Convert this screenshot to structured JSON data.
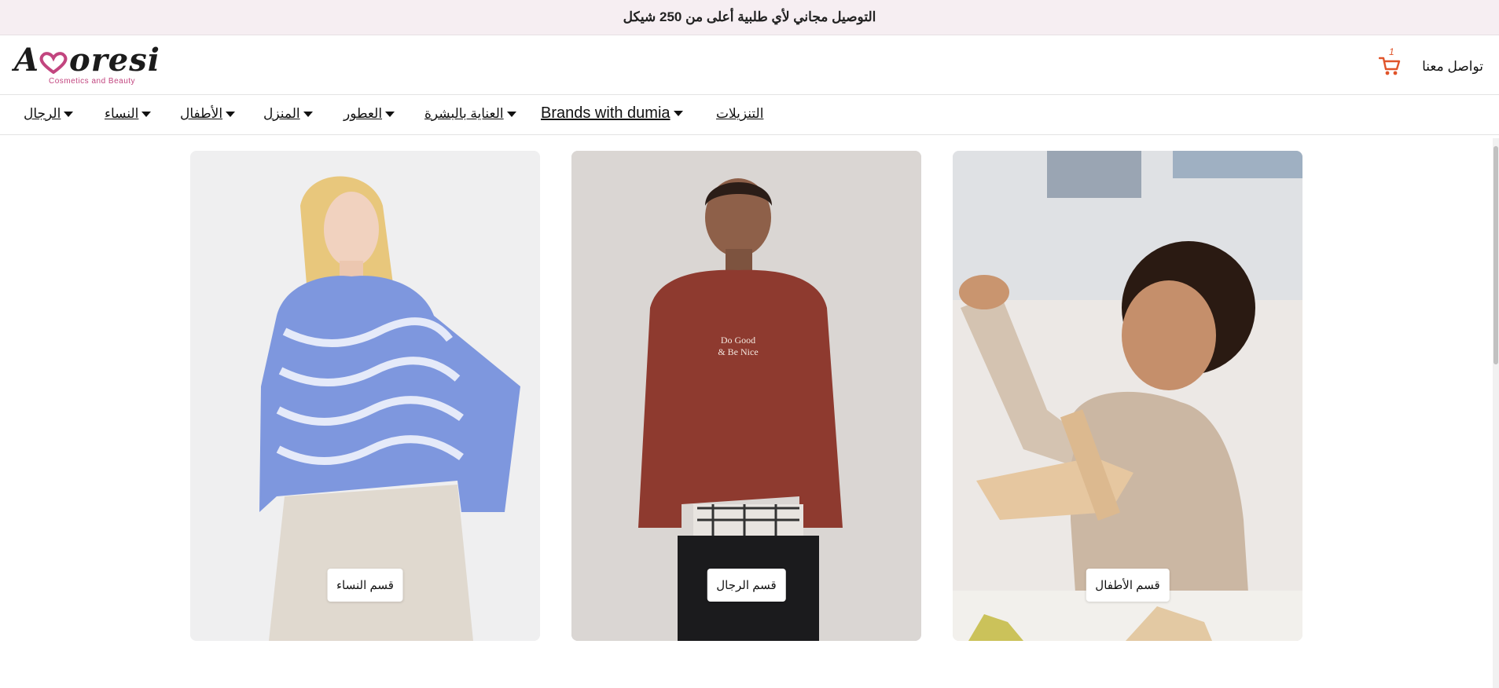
{
  "announcement": "التوصيل مجاني لأي طلبية أعلى من 250 شيكل",
  "logo": {
    "text": "Amoresi",
    "tagline": "Cosmetics and Beauty"
  },
  "header": {
    "contact_label": "تواصل معنا",
    "cart_count": "1",
    "accent_color": "#e0542a"
  },
  "nav": {
    "items": [
      {
        "label": "الرجال",
        "has_dropdown": true
      },
      {
        "label": "النساء",
        "has_dropdown": true
      },
      {
        "label": "الأطفال",
        "has_dropdown": true
      },
      {
        "label": "المنزل",
        "has_dropdown": true
      },
      {
        "label": "العطور",
        "has_dropdown": true
      },
      {
        "label": "العناية بالبشرة",
        "has_dropdown": true
      },
      {
        "label": "Brands with dumia",
        "has_dropdown": true
      },
      {
        "label": "التنزيلات",
        "has_dropdown": false
      }
    ]
  },
  "categories": [
    {
      "button_label": "قسم النساء",
      "icon": "woman-photo"
    },
    {
      "button_label": "قسم الرجال",
      "icon": "man-photo"
    },
    {
      "button_label": "قسم الأطفال",
      "icon": "child-photo"
    }
  ]
}
